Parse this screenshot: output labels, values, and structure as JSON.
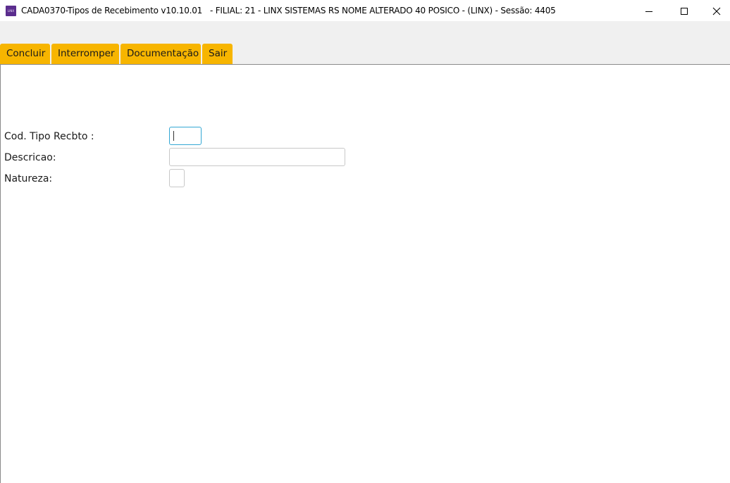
{
  "window": {
    "title": "CADA0370-Tipos de Recebimento v10.10.01   - FILIAL: 21 - LINX SISTEMAS RS NOME ALTERADO 40 POSICO - (LINX) - Sessão: 4405",
    "icon_text": "LINX",
    "icon_color": "#5b2d8e"
  },
  "toolbar": {
    "accent": "#f7b500",
    "tabs": [
      {
        "label": "Concluir"
      },
      {
        "label": "Interromper"
      },
      {
        "label": "Documentação"
      },
      {
        "label": "Sair"
      }
    ]
  },
  "form": {
    "cod_tipo": {
      "label": "Cod. Tipo Recbto :",
      "value": ""
    },
    "descricao": {
      "label": "Descricao:",
      "value": ""
    },
    "natureza": {
      "label": "Natureza:",
      "value": ""
    }
  }
}
